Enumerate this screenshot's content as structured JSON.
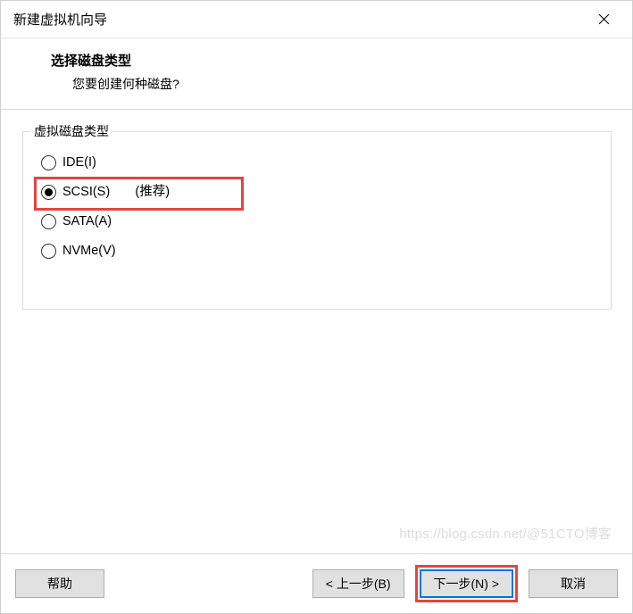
{
  "titlebar": {
    "title": "新建虚拟机向导"
  },
  "header": {
    "title": "选择磁盘类型",
    "subtitle": "您要创建何种磁盘?"
  },
  "fieldset": {
    "legend": "虚拟磁盘类型",
    "options": [
      {
        "label": "IDE(I)",
        "checked": false
      },
      {
        "label": "SCSI(S)       (推荐)",
        "checked": true
      },
      {
        "label": "SATA(A)",
        "checked": false
      },
      {
        "label": "NVMe(V)",
        "checked": false
      }
    ]
  },
  "footer": {
    "help": "帮助",
    "back": "< 上一步(B)",
    "next": "下一步(N) >",
    "cancel": "取消"
  },
  "watermark": "https://blog.csdn.net/@51CTO博客"
}
